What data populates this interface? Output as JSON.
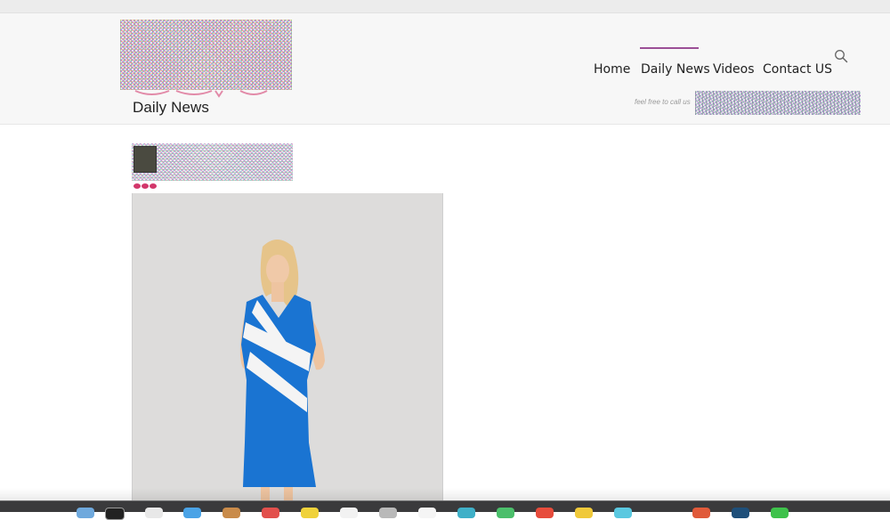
{
  "site": {
    "page_title": "Daily News",
    "logo_name": "site-logo"
  },
  "nav": {
    "items": [
      {
        "label": "Home",
        "active": false
      },
      {
        "label": "Daily News",
        "active": true
      },
      {
        "label": "Videos",
        "active": false
      },
      {
        "label": "Contact US",
        "active": false
      }
    ],
    "accent_color": "#9b4f96",
    "search_icon": "search-icon"
  },
  "header": {
    "call_text": "feel free to call us"
  },
  "post": {
    "rating_icons": [
      "lips-icon",
      "lips-icon",
      "lips-icon"
    ],
    "image_name": "woman-blue-white-dress-photo"
  },
  "dock": {
    "icons": [
      "app-icon",
      "app-icon",
      "app-icon",
      "app-icon",
      "app-icon",
      "app-icon",
      "app-icon",
      "app-icon",
      "app-icon",
      "app-icon",
      "app-icon",
      "app-icon",
      "app-icon",
      "app-icon",
      "app-icon",
      "app-icon",
      "app-icon",
      "app-icon"
    ]
  }
}
